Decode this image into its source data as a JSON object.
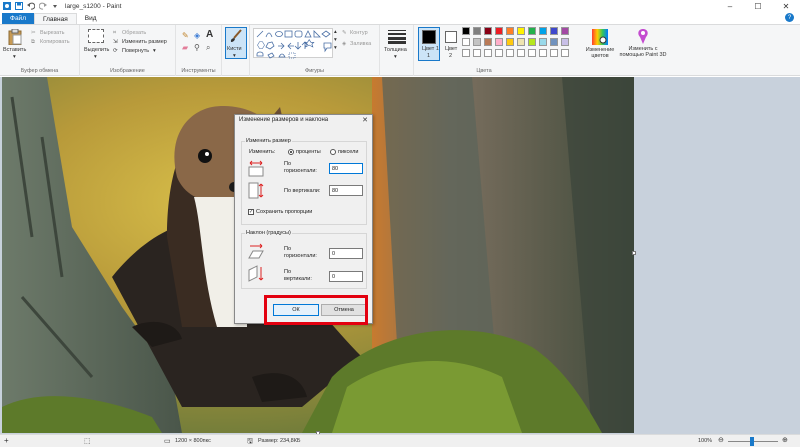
{
  "window": {
    "title": "large_s1200 - Paint"
  },
  "tabs": {
    "file": "Файл",
    "home": "Главная",
    "view": "Вид"
  },
  "ribbon": {
    "clipboard": {
      "paste": "Вставить",
      "cut": "Вырезать",
      "copy": "Копировать",
      "label": "Буфер обмена"
    },
    "image": {
      "select": "Выделить",
      "crop": "Обрезать",
      "resize": "Изменить размер",
      "rotate": "Повернуть",
      "label": "Изображение"
    },
    "tools": {
      "label": "Инструменты"
    },
    "brushes": "Кисти",
    "shapes": {
      "outline": "Контур",
      "fill": "Заливка",
      "label": "Фигуры"
    },
    "size": "Толщина",
    "colors": {
      "color1": "Цвет 1",
      "color1_number": "1",
      "color2": "Цвет",
      "color2_number": "2",
      "edit": "Изменение цветов",
      "paint3d": "Изменить с помощью Paint 3D",
      "label": "Цвета",
      "palette_row1": [
        "#000000",
        "#7f7f7f",
        "#880015",
        "#ed1c24",
        "#ff7f27",
        "#fff200",
        "#22b14c",
        "#00a2e8",
        "#3f48cc",
        "#a349a4"
      ],
      "palette_row2": [
        "#ffffff",
        "#c3c3c3",
        "#b97a57",
        "#ffaec9",
        "#ffc90e",
        "#efe4b0",
        "#b5e61d",
        "#99d9ea",
        "#7092be",
        "#c8bfe7"
      ],
      "palette_row3": [
        "#ffffff",
        "#ffffff",
        "#ffffff",
        "#ffffff",
        "#ffffff",
        "#ffffff",
        "#ffffff",
        "#ffffff",
        "#ffffff",
        "#ffffff"
      ]
    }
  },
  "dialog": {
    "title": "Изменение размеров и наклона",
    "close": "✕",
    "resize_group": "Изменить размер",
    "by_label": "Изменить:",
    "percent": "проценты",
    "pixels": "пиксели",
    "horizontal_label_1": "По",
    "horizontal_label_2": "горизонтали:",
    "horizontal_value": "80",
    "vertical_label": "По вертикали:",
    "vertical_value": "80",
    "keep_ratio": "Сохранить пропорции",
    "skew_group": "Наклон (градусы)",
    "skew_h_label_1": "По",
    "skew_h_label_2": "горизонтали:",
    "skew_h_value": "0",
    "skew_v_label_1": "По",
    "skew_v_label_2": "вертикали:",
    "skew_v_value": "0",
    "ok": "ОК",
    "cancel": "Отмена"
  },
  "status": {
    "dimensions": "1200 × 800пкс",
    "file_size": "Размер: 234,8КБ",
    "zoom": "100%"
  },
  "accent": "#1979ca",
  "highlight_color": "#e3000f"
}
